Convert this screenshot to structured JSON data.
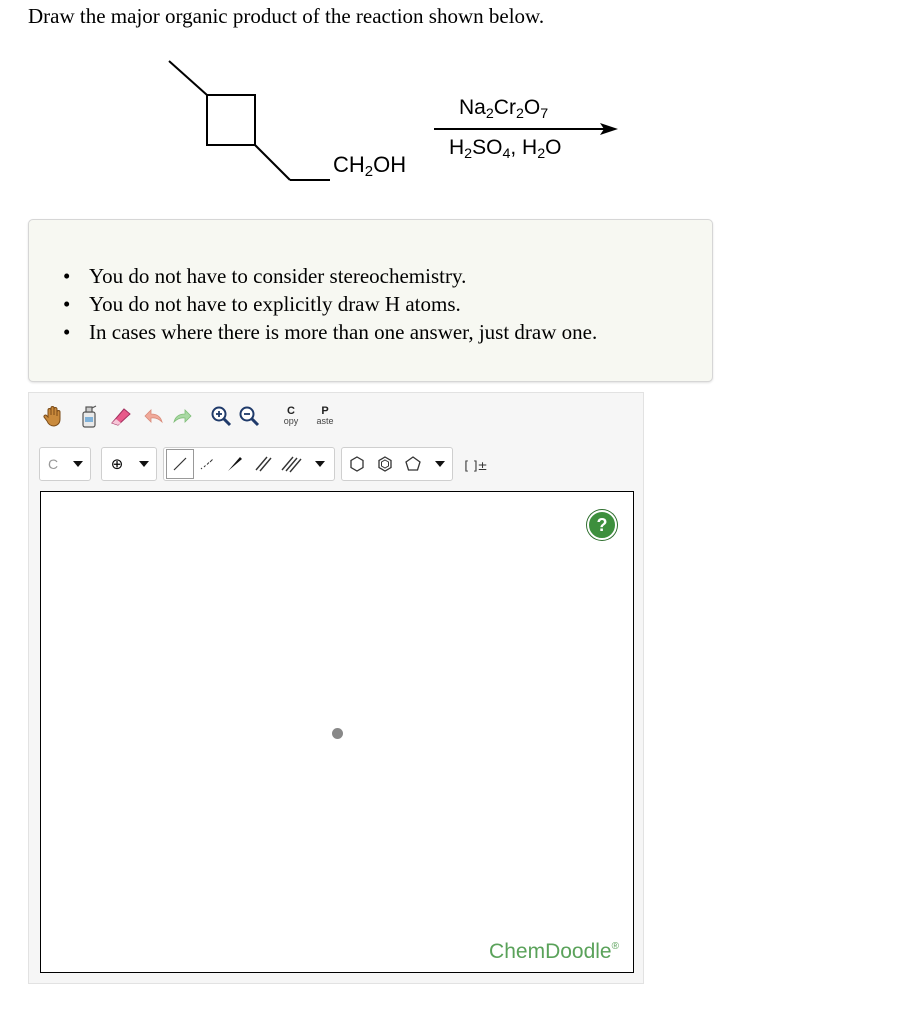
{
  "question": "Draw the major organic product of the reaction shown below.",
  "reaction": {
    "substituent_label": {
      "main": "CH",
      "sub": "2",
      "end": "OH"
    },
    "reagent_top": {
      "a": "Na",
      "a_sub": "2",
      "b": "Cr",
      "b_sub": "2",
      "c": "O",
      "c_sub": "7"
    },
    "reagent_bottom": {
      "a": "H",
      "a_sub": "2",
      "b": "SO",
      "b_sub": "4",
      "sep": ", H",
      "c_sub": "2",
      "end": "O"
    }
  },
  "notes": [
    "You do not have to consider stereochemistry.",
    "You do not have to explicitly draw H atoms.",
    "In cases where there is more than one answer, just draw one."
  ],
  "toolbar": {
    "copy_top": "C",
    "copy_bottom": "opy",
    "paste_top": "P",
    "paste_bottom": "aste",
    "atom_label": "C",
    "charge_symbol": "⊕",
    "bracket_label": "[ ]±"
  },
  "canvas": {
    "help_label": "?",
    "brand_name": "ChemDoodle",
    "brand_mark": "®"
  },
  "colors": {
    "brand": "#5aa25a",
    "help_bg": "#3d8f3d",
    "notes_bg": "#f7f8f2"
  }
}
